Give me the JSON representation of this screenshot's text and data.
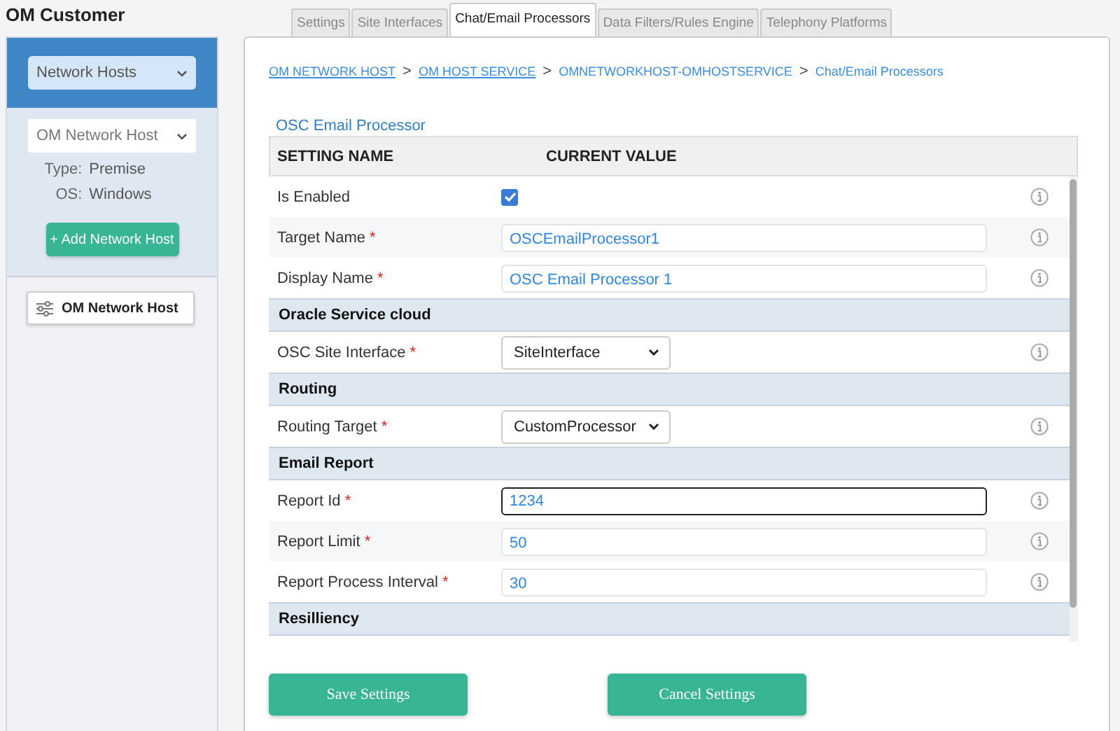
{
  "app_title": "OM Customer",
  "sidebar": {
    "category_select": "Network Hosts",
    "host_select": "OM Network Host",
    "type_label": "Type:",
    "type_value": "Premise",
    "os_label": "OS:",
    "os_value": "Windows",
    "add_button": "+ Add Network Host",
    "items": [
      {
        "label": "OM Network Host",
        "selected": true
      }
    ]
  },
  "tabs": [
    {
      "label": "Settings",
      "selected": false
    },
    {
      "label": "Site Interfaces",
      "selected": false
    },
    {
      "label": "Chat/Email Processors",
      "selected": true
    },
    {
      "label": "Data Filters/Rules Engine",
      "selected": false
    },
    {
      "label": "Telephony Platforms",
      "selected": false
    }
  ],
  "breadcrumb": [
    {
      "label": "OM NETWORK HOST",
      "kind": "link"
    },
    {
      "label": "OM HOST SERVICE",
      "kind": "link"
    },
    {
      "label": "OMNETWORKHOST-OMHOSTSERVICE",
      "kind": "plain"
    },
    {
      "label": "Chat/Email Processors",
      "kind": "plain"
    }
  ],
  "breadcrumb_separator": ">",
  "section_title": "OSC Email Processor",
  "table": {
    "columns": [
      "SETTING NAME",
      "CURRENT VALUE"
    ],
    "rows": [
      {
        "kind": "checkbox",
        "label": "Is Enabled",
        "required": false,
        "checked": true
      },
      {
        "kind": "text",
        "label": "Target Name",
        "required": true,
        "value": "OSCEmailProcessor1",
        "focused": false
      },
      {
        "kind": "text",
        "label": "Display Name",
        "required": true,
        "value": "OSC Email Processor 1",
        "focused": false
      },
      {
        "kind": "section",
        "label": "Oracle Service cloud"
      },
      {
        "kind": "select",
        "label": "OSC Site Interface",
        "required": true,
        "value": "SiteInterface"
      },
      {
        "kind": "section",
        "label": "Routing"
      },
      {
        "kind": "select",
        "label": "Routing Target",
        "required": true,
        "value": "CustomProcessor"
      },
      {
        "kind": "section",
        "label": "Email Report"
      },
      {
        "kind": "text",
        "label": "Report Id",
        "required": true,
        "value": "1234",
        "focused": true
      },
      {
        "kind": "text",
        "label": "Report Limit",
        "required": true,
        "value": "50",
        "focused": false
      },
      {
        "kind": "text",
        "label": "Report Process Interval",
        "required": true,
        "value": "30",
        "focused": false
      },
      {
        "kind": "section",
        "label": "Resilliency"
      }
    ]
  },
  "required_mark": "*",
  "buttons": [
    {
      "label": "Save Settings"
    },
    {
      "label": "Cancel Settings"
    }
  ]
}
